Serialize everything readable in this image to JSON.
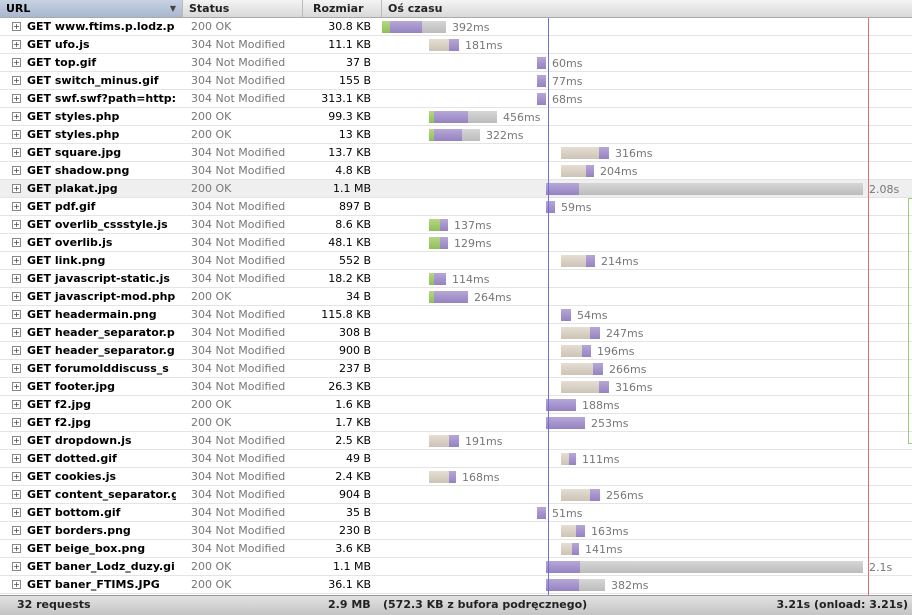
{
  "header": {
    "url_label": "URL",
    "status_label": "Status",
    "size_label": "Rozmiar",
    "timeline_label": "Oś czasu",
    "sort_icon": "triangle-down"
  },
  "rows": [
    {
      "url": "GET www.ftims.p.lodz.p",
      "status": "200 OK",
      "size": "30.8 KB",
      "duration": "392ms",
      "bar": {
        "start": 0,
        "segments": [
          [
            "green",
            8
          ],
          [
            "purple",
            32
          ],
          [
            "gray",
            24
          ]
        ]
      }
    },
    {
      "url": "GET ufo.js",
      "status": "304 Not Modified",
      "size": "11.1 KB",
      "duration": "181ms",
      "bar": {
        "start": 47,
        "segments": [
          [
            "beige",
            20
          ],
          [
            "purple",
            10
          ]
        ]
      }
    },
    {
      "url": "GET top.gif",
      "status": "304 Not Modified",
      "size": "37 B",
      "duration": "60ms",
      "bar": {
        "start": 155,
        "segments": [
          [
            "purple",
            9
          ]
        ]
      }
    },
    {
      "url": "GET switch_minus.gif",
      "status": "304 Not Modified",
      "size": "155 B",
      "duration": "77ms",
      "bar": {
        "start": 155,
        "segments": [
          [
            "purple",
            9
          ]
        ]
      }
    },
    {
      "url": "GET swf.swf?path=http:",
      "status": "304 Not Modified",
      "size": "313.1 KB",
      "duration": "68ms",
      "bar": {
        "start": 155,
        "segments": [
          [
            "purple",
            9
          ]
        ]
      }
    },
    {
      "url": "GET styles.php",
      "status": "200 OK",
      "size": "99.3 KB",
      "duration": "456ms",
      "bar": {
        "start": 47,
        "segments": [
          [
            "green",
            5
          ],
          [
            "purple",
            34
          ],
          [
            "gray",
            29
          ]
        ]
      }
    },
    {
      "url": "GET styles.php",
      "status": "200 OK",
      "size": "13 KB",
      "duration": "322ms",
      "bar": {
        "start": 47,
        "segments": [
          [
            "green",
            5
          ],
          [
            "purple",
            28
          ],
          [
            "gray",
            18
          ]
        ]
      }
    },
    {
      "url": "GET square.jpg",
      "status": "304 Not Modified",
      "size": "13.7 KB",
      "duration": "316ms",
      "bar": {
        "start": 179,
        "segments": [
          [
            "beige",
            38
          ],
          [
            "purple",
            10
          ]
        ]
      }
    },
    {
      "url": "GET shadow.png",
      "status": "304 Not Modified",
      "size": "4.8 KB",
      "duration": "204ms",
      "bar": {
        "start": 179,
        "segments": [
          [
            "beige",
            25
          ],
          [
            "purple",
            8
          ]
        ]
      }
    },
    {
      "url": "GET plakat.jpg",
      "status": "200 OK",
      "size": "1.1 MB",
      "duration": "2.08s",
      "bar": {
        "start": 164,
        "segments": [
          [
            "purple",
            33
          ],
          [
            "gray",
            284
          ]
        ]
      }
    },
    {
      "url": "GET pdf.gif",
      "status": "304 Not Modified",
      "size": "897 B",
      "duration": "59ms",
      "bar": {
        "start": 164,
        "segments": [
          [
            "purple",
            9
          ]
        ]
      }
    },
    {
      "url": "GET overlib_cssstyle.js",
      "status": "304 Not Modified",
      "size": "8.6 KB",
      "duration": "137ms",
      "bar": {
        "start": 47,
        "segments": [
          [
            "green",
            11
          ],
          [
            "purple",
            8
          ]
        ]
      }
    },
    {
      "url": "GET overlib.js",
      "status": "304 Not Modified",
      "size": "48.1 KB",
      "duration": "129ms",
      "bar": {
        "start": 47,
        "segments": [
          [
            "green",
            11
          ],
          [
            "purple",
            8
          ]
        ]
      }
    },
    {
      "url": "GET link.png",
      "status": "304 Not Modified",
      "size": "552 B",
      "duration": "214ms",
      "bar": {
        "start": 179,
        "segments": [
          [
            "beige",
            25
          ],
          [
            "purple",
            9
          ]
        ]
      }
    },
    {
      "url": "GET javascript-static.js",
      "status": "304 Not Modified",
      "size": "18.2 KB",
      "duration": "114ms",
      "bar": {
        "start": 47,
        "segments": [
          [
            "green",
            5
          ],
          [
            "purple",
            12
          ]
        ]
      }
    },
    {
      "url": "GET javascript-mod.php",
      "status": "200 OK",
      "size": "34 B",
      "duration": "264ms",
      "bar": {
        "start": 47,
        "segments": [
          [
            "green",
            5
          ],
          [
            "purple",
            34
          ]
        ]
      }
    },
    {
      "url": "GET headermain.png",
      "status": "304 Not Modified",
      "size": "115.8 KB",
      "duration": "54ms",
      "bar": {
        "start": 179,
        "segments": [
          [
            "purple",
            10
          ]
        ]
      }
    },
    {
      "url": "GET header_separator.p",
      "status": "304 Not Modified",
      "size": "308 B",
      "duration": "247ms",
      "bar": {
        "start": 179,
        "segments": [
          [
            "beige",
            29
          ],
          [
            "purple",
            10
          ]
        ]
      }
    },
    {
      "url": "GET header_separator.g",
      "status": "304 Not Modified",
      "size": "900 B",
      "duration": "196ms",
      "bar": {
        "start": 179,
        "segments": [
          [
            "beige",
            21
          ],
          [
            "purple",
            9
          ]
        ]
      }
    },
    {
      "url": "GET forumolddiscuss_s",
      "status": "304 Not Modified",
      "size": "237 B",
      "duration": "266ms",
      "bar": {
        "start": 179,
        "segments": [
          [
            "beige",
            32
          ],
          [
            "purple",
            10
          ]
        ]
      }
    },
    {
      "url": "GET footer.jpg",
      "status": "304 Not Modified",
      "size": "26.3 KB",
      "duration": "316ms",
      "bar": {
        "start": 179,
        "segments": [
          [
            "beige",
            38
          ],
          [
            "purple",
            10
          ]
        ]
      }
    },
    {
      "url": "GET f2.jpg",
      "status": "200 OK",
      "size": "1.6 KB",
      "duration": "188ms",
      "bar": {
        "start": 164,
        "segments": [
          [
            "purple",
            30
          ]
        ]
      }
    },
    {
      "url": "GET f2.jpg",
      "status": "200 OK",
      "size": "1.7 KB",
      "duration": "253ms",
      "bar": {
        "start": 164,
        "segments": [
          [
            "purple",
            39
          ]
        ]
      }
    },
    {
      "url": "GET dropdown.js",
      "status": "304 Not Modified",
      "size": "2.5 KB",
      "duration": "191ms",
      "bar": {
        "start": 47,
        "segments": [
          [
            "beige",
            20
          ],
          [
            "purple",
            10
          ]
        ]
      }
    },
    {
      "url": "GET dotted.gif",
      "status": "304 Not Modified",
      "size": "49 B",
      "duration": "111ms",
      "bar": {
        "start": 179,
        "segments": [
          [
            "beige",
            8
          ],
          [
            "purple",
            7
          ]
        ]
      }
    },
    {
      "url": "GET cookies.js",
      "status": "304 Not Modified",
      "size": "2.4 KB",
      "duration": "168ms",
      "bar": {
        "start": 47,
        "segments": [
          [
            "beige",
            20
          ],
          [
            "purple",
            7
          ]
        ]
      }
    },
    {
      "url": "GET content_separator.g",
      "status": "304 Not Modified",
      "size": "904 B",
      "duration": "256ms",
      "bar": {
        "start": 179,
        "segments": [
          [
            "beige",
            29
          ],
          [
            "purple",
            10
          ]
        ]
      }
    },
    {
      "url": "GET bottom.gif",
      "status": "304 Not Modified",
      "size": "35 B",
      "duration": "51ms",
      "bar": {
        "start": 155,
        "segments": [
          [
            "purple",
            9
          ]
        ]
      }
    },
    {
      "url": "GET borders.png",
      "status": "304 Not Modified",
      "size": "230 B",
      "duration": "163ms",
      "bar": {
        "start": 179,
        "segments": [
          [
            "beige",
            15
          ],
          [
            "purple",
            9
          ]
        ]
      }
    },
    {
      "url": "GET beige_box.png",
      "status": "304 Not Modified",
      "size": "3.6 KB",
      "duration": "141ms",
      "bar": {
        "start": 179,
        "segments": [
          [
            "beige",
            11
          ],
          [
            "purple",
            7
          ]
        ]
      }
    },
    {
      "url": "GET baner_Lodz_duzy.gi",
      "status": "200 OK",
      "size": "1.1 MB",
      "duration": "2.1s",
      "bar": {
        "start": 164,
        "segments": [
          [
            "purple",
            34
          ],
          [
            "gray",
            283
          ]
        ]
      }
    },
    {
      "url": "GET baner_FTIMS.JPG",
      "status": "200 OK",
      "size": "36.1 KB",
      "duration": "382ms",
      "bar": {
        "start": 164,
        "segments": [
          [
            "purple",
            33
          ],
          [
            "gray",
            26
          ]
        ]
      }
    }
  ],
  "highlighted_row": 9,
  "colors": {
    "green": "#9bc96b",
    "beige": "#d8cfc3",
    "purple": "#a392cc",
    "gray": "#c8c8c8",
    "dom_line": "#6f6fe0",
    "onload_line": "#e07070"
  },
  "footer": {
    "requests": "32 requests",
    "total_size": "2.9 MB",
    "cache": "(572.3 KB z bufora podręcznego)",
    "total_time": "3.21s (onload: 3.21s)"
  }
}
